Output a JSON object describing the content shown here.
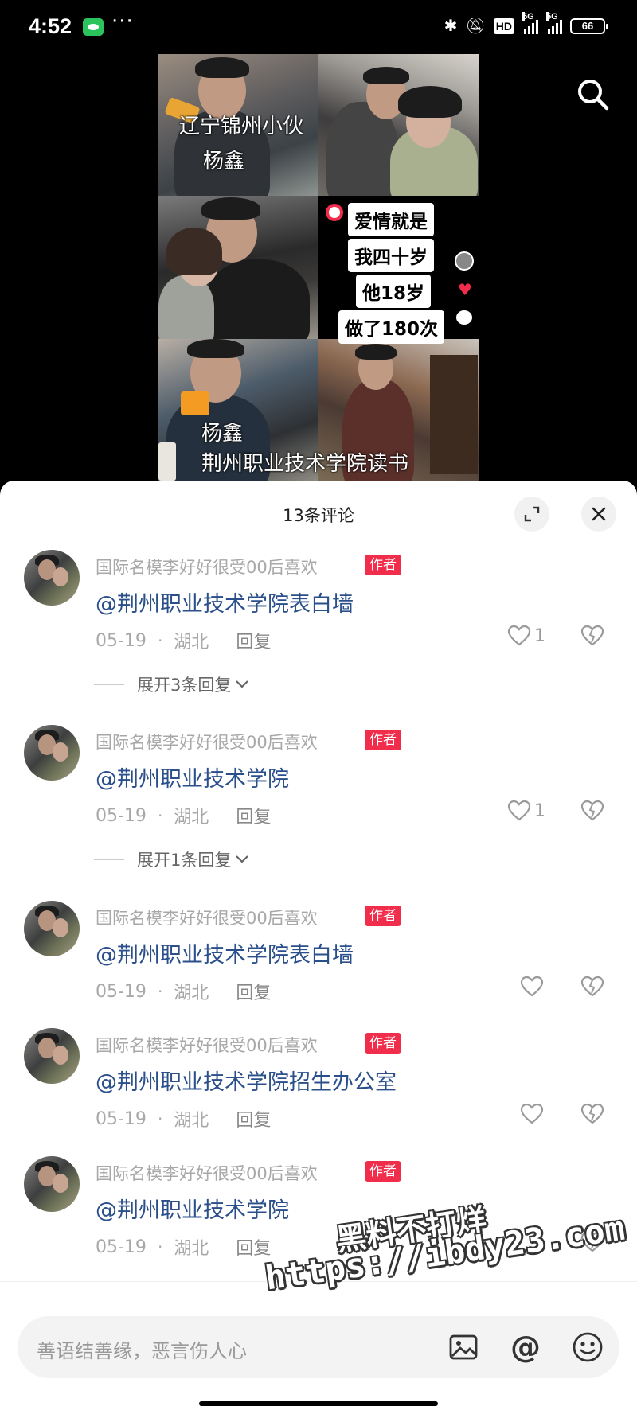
{
  "status_bar": {
    "time": "4:52",
    "more": "···",
    "hd": "HD",
    "net1": "5G",
    "net2": "5G",
    "battery": "66"
  },
  "video": {
    "overlay_1": "辽宁锦州小伙",
    "overlay_2": "杨鑫",
    "love_lines": [
      "爱情就是",
      "我四十岁",
      "他18岁",
      "做了180次"
    ],
    "overlay_3": "杨鑫",
    "overlay_4": "荆州职业技术学院读书"
  },
  "sheet": {
    "title": "13条评论"
  },
  "comments": [
    {
      "user": "国际名模李好好很受00后喜欢",
      "badge": "作者",
      "text": "@荆州职业技术学院表白墙",
      "date": "05-19",
      "region": "湖北",
      "reply": "回复",
      "likes": "1",
      "expand": "展开3条回复"
    },
    {
      "user": "国际名模李好好很受00后喜欢",
      "badge": "作者",
      "text": "@荆州职业技术学院",
      "date": "05-19",
      "region": "湖北",
      "reply": "回复",
      "likes": "1",
      "expand": "展开1条回复"
    },
    {
      "user": "国际名模李好好很受00后喜欢",
      "badge": "作者",
      "text": "@荆州职业技术学院表白墙",
      "date": "05-19",
      "region": "湖北",
      "reply": "回复",
      "likes": ""
    },
    {
      "user": "国际名模李好好很受00后喜欢",
      "badge": "作者",
      "text": "@荆州职业技术学院招生办公室",
      "date": "05-19",
      "region": "湖北",
      "reply": "回复",
      "likes": ""
    },
    {
      "user": "国际名模李好好很受00后喜欢",
      "badge": "作者",
      "text": "@荆州职业技术学院",
      "date": "05-19",
      "region": "湖北",
      "reply": "回复",
      "likes": ""
    }
  ],
  "input": {
    "placeholder": "善语结善缘，恶言伤人心",
    "at_symbol": "@"
  },
  "watermark": {
    "line1": "黑料不打烊",
    "line2": "https://ibdy23.com"
  },
  "colors": {
    "author_badge": "#f02e4b",
    "mention_link": "#2a4f8a",
    "sheet_bg": "#ffffff"
  }
}
